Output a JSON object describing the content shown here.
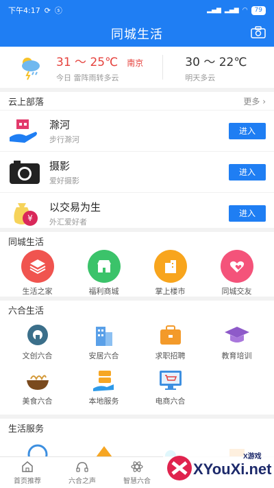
{
  "status": {
    "time": "下午4:17",
    "battery": "79"
  },
  "header": {
    "title": "同城生活"
  },
  "weather": {
    "today_temp": "31 ～ 25℃",
    "city": "南京",
    "today_desc": "今日 雷阵雨转多云",
    "tomorrow_temp": "30 ～ 22℃",
    "tomorrow_desc": "明天多云"
  },
  "tribe": {
    "heading": "云上部落",
    "more": "更多",
    "join_label": "进入",
    "items": [
      {
        "name": "滁河",
        "sub": "步行滁河"
      },
      {
        "name": "摄影",
        "sub": "爱好摄影"
      },
      {
        "name": "以交易为生",
        "sub": "外汇爱好者"
      }
    ]
  },
  "city_life": {
    "heading": "同城生活",
    "items": [
      {
        "label": "生活之家",
        "color": "#f0544f"
      },
      {
        "label": "福利商城",
        "color": "#3bc36a"
      },
      {
        "label": "掌上楼市",
        "color": "#f8a51d"
      },
      {
        "label": "同城交友",
        "color": "#f4537a"
      }
    ]
  },
  "liuhe_life": {
    "heading": "六合生活",
    "row1": [
      {
        "label": "文创六合"
      },
      {
        "label": "安居六合"
      },
      {
        "label": "求职招聘"
      },
      {
        "label": "教育培训"
      }
    ],
    "row2": [
      {
        "label": "美食六合"
      },
      {
        "label": "本地服务"
      },
      {
        "label": "电商六合"
      }
    ]
  },
  "services": {
    "heading": "生活服务"
  },
  "tabs": [
    {
      "label": "首页推荐"
    },
    {
      "label": "六合之声"
    },
    {
      "label": "智慧六合"
    }
  ],
  "watermark": {
    "brand": "XYouXi.net",
    "small": "X游戏"
  }
}
